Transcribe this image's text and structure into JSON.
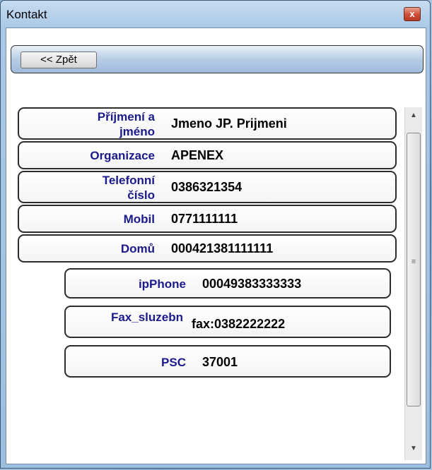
{
  "window": {
    "title": "Kontakt",
    "close_glyph": "x"
  },
  "toolbar": {
    "back_label": "<< Zpět"
  },
  "fields": [
    {
      "label_line1": "Příjmení a",
      "label_line2": "jméno",
      "value": "Jmeno JP. Prijmeni"
    },
    {
      "label": "Organizace",
      "value": "APENEX"
    },
    {
      "label_line1": "Telefonní",
      "label_line2": "číslo",
      "value": "0386321354"
    },
    {
      "label": "Mobil",
      "value": "0771111111"
    },
    {
      "label": "Domů",
      "value": "000421381111111"
    },
    {
      "label": "ipPhone",
      "value": "00049383333333"
    },
    {
      "label": "Fax_sluzebn",
      "value": "fax:0382222222"
    },
    {
      "label": "PSC",
      "value": "37001"
    }
  ],
  "scrollbar": {
    "up_icon": "▲",
    "down_icon": "▼",
    "grip_icon": "≡"
  },
  "colors": {
    "label": "#1a1a8c",
    "value": "#000000",
    "toolbar": "#b7cde6"
  }
}
